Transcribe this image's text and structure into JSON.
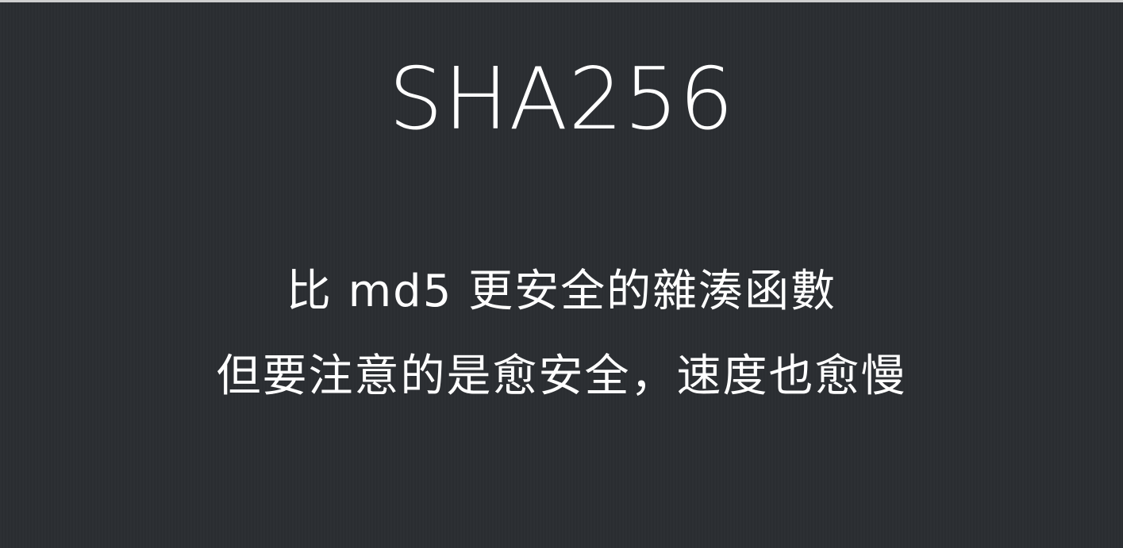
{
  "slide": {
    "title": "SHA256",
    "lines": [
      "比 md5 更安全的雜湊函數",
      "但要注意的是愈安全，速度也愈慢"
    ]
  },
  "colors": {
    "background": "#2c2f33",
    "text": "#ffffff"
  }
}
